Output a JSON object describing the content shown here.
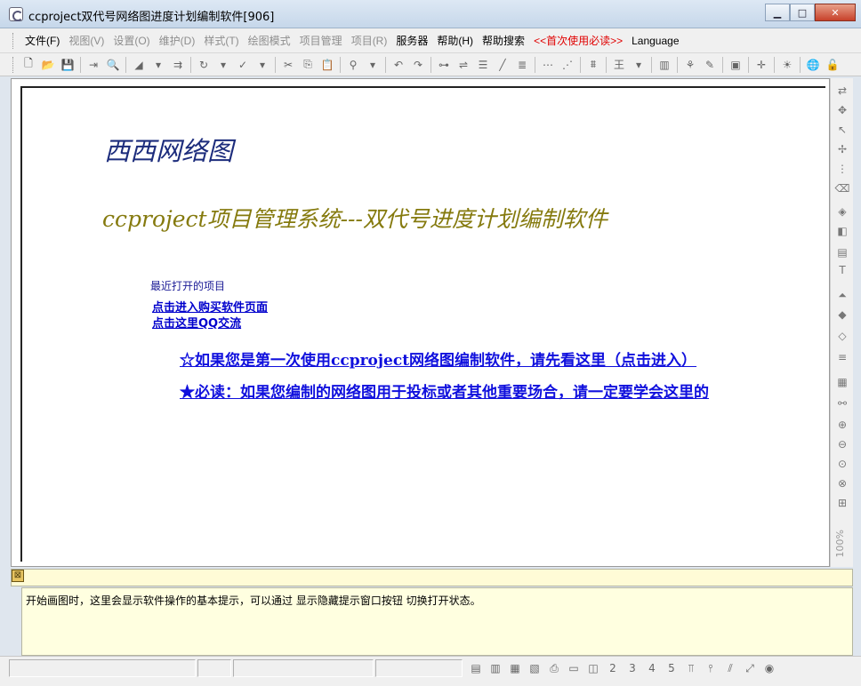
{
  "window": {
    "title": "ccproject双代号网络图进度计划编制软件[906]",
    "minimize": "▁",
    "maximize": "□",
    "close": "✕"
  },
  "menu": [
    {
      "label": "文件(F)",
      "enabled": true,
      "name": "menu-file"
    },
    {
      "label": "视图(V)",
      "enabled": false,
      "name": "menu-view"
    },
    {
      "label": "设置(O)",
      "enabled": false,
      "name": "menu-settings"
    },
    {
      "label": "维护(D)",
      "enabled": false,
      "name": "menu-maintain"
    },
    {
      "label": "样式(T)",
      "enabled": false,
      "name": "menu-style"
    },
    {
      "label": "绘图模式",
      "enabled": false,
      "name": "menu-draw-mode"
    },
    {
      "label": "项目管理",
      "enabled": false,
      "name": "menu-project-mgmt"
    },
    {
      "label": "项目(R)",
      "enabled": false,
      "name": "menu-project"
    },
    {
      "label": "服务器",
      "enabled": true,
      "name": "menu-server"
    },
    {
      "label": "帮助(H)",
      "enabled": true,
      "name": "menu-help"
    },
    {
      "label": "帮助搜索",
      "enabled": true,
      "name": "menu-help-search"
    },
    {
      "label": "<<首次使用必读>>",
      "enabled": true,
      "highlight": "#e00000",
      "name": "menu-first-use"
    },
    {
      "label": "Language",
      "enabled": true,
      "name": "menu-language"
    }
  ],
  "toolbar": [
    {
      "icon": "new-file-icon",
      "glyph": "🗋",
      "enabled": true
    },
    {
      "icon": "open-folder-icon",
      "glyph": "📂",
      "enabled": true
    },
    {
      "icon": "save-icon",
      "glyph": "💾",
      "enabled": false
    },
    {
      "sep": true
    },
    {
      "icon": "export-icon",
      "glyph": "⇥",
      "enabled": false
    },
    {
      "icon": "print-preview-icon",
      "glyph": "🔍",
      "enabled": false
    },
    {
      "sep": true
    },
    {
      "icon": "fill-color-icon",
      "glyph": "◢",
      "enabled": false
    },
    {
      "icon": "dropdown-arrow-icon",
      "glyph": "▾",
      "enabled": false
    },
    {
      "icon": "indent-icon",
      "glyph": "⇉",
      "enabled": false
    },
    {
      "sep": true
    },
    {
      "icon": "rotate-icon",
      "glyph": "↻",
      "enabled": false
    },
    {
      "icon": "dropdown-arrow-icon",
      "glyph": "▾",
      "enabled": false
    },
    {
      "icon": "check-icon",
      "glyph": "✓",
      "enabled": false
    },
    {
      "icon": "dropdown-arrow-icon",
      "glyph": "▾",
      "enabled": false
    },
    {
      "sep": true
    },
    {
      "icon": "cut-icon",
      "glyph": "✂",
      "enabled": false
    },
    {
      "icon": "copy-icon",
      "glyph": "⎘",
      "enabled": false
    },
    {
      "icon": "paste-icon",
      "glyph": "📋",
      "enabled": false
    },
    {
      "sep": true
    },
    {
      "icon": "find-binoculars-icon",
      "glyph": "⚲",
      "enabled": false
    },
    {
      "icon": "dropdown-arrow-icon",
      "glyph": "▾",
      "enabled": false
    },
    {
      "sep": true
    },
    {
      "icon": "undo-icon",
      "glyph": "↶",
      "enabled": false
    },
    {
      "icon": "redo-icon",
      "glyph": "↷",
      "enabled": false
    },
    {
      "sep": true
    },
    {
      "icon": "network-node-icon",
      "glyph": "⊶",
      "enabled": false
    },
    {
      "icon": "link-icon",
      "glyph": "⇌",
      "enabled": false
    },
    {
      "icon": "align-icon",
      "glyph": "☰",
      "enabled": false
    },
    {
      "icon": "line-icon",
      "glyph": "╱",
      "enabled": false
    },
    {
      "icon": "layer-icon",
      "glyph": "≣",
      "enabled": false
    },
    {
      "sep": true
    },
    {
      "icon": "node-row-icon",
      "glyph": "⋯",
      "enabled": false
    },
    {
      "icon": "node-row2-icon",
      "glyph": "⋰",
      "enabled": false
    },
    {
      "sep": true
    },
    {
      "icon": "arrange-icon",
      "glyph": "⩩",
      "enabled": false
    },
    {
      "sep": true
    },
    {
      "icon": "text-align-icon",
      "glyph": "王",
      "enabled": false
    },
    {
      "icon": "dropdown-arrow-icon",
      "glyph": "▾",
      "enabled": false
    },
    {
      "sep": true
    },
    {
      "icon": "bar-chart-icon",
      "glyph": "▥",
      "enabled": false
    },
    {
      "sep": true
    },
    {
      "icon": "resource-icon",
      "glyph": "⚘",
      "enabled": false
    },
    {
      "icon": "edit-doc-icon",
      "glyph": "✎",
      "enabled": false
    },
    {
      "sep": true
    },
    {
      "icon": "frame-icon",
      "glyph": "▣",
      "enabled": false
    },
    {
      "sep": true
    },
    {
      "icon": "add-node-icon",
      "glyph": "✛",
      "enabled": false
    },
    {
      "sep": true
    },
    {
      "icon": "tip-bulb-icon",
      "glyph": "☀",
      "enabled": false
    },
    {
      "sep": true
    },
    {
      "icon": "globe-icon",
      "glyph": "🌐",
      "enabled": true,
      "globe": true
    },
    {
      "icon": "unlock-icon",
      "glyph": "🔓",
      "enabled": true
    }
  ],
  "canvas": {
    "brand": "西西网络图",
    "subtitle": "ccproject项目管理系统---双代号进度计划编制软件",
    "recent_label": "最近打开的项目",
    "link_buy": "点击进入购买软件页面",
    "link_qq": "点击这里QQ交流",
    "first_use_link": "☆如果您是第一次使用ccproject网络图编制软件，请先看这里（点击进入）",
    "must_read_link": "★必读：如果您编制的网络图用于投标或者其他重要场合，请一定要学会这里的"
  },
  "side_toolbar": [
    {
      "icon": "move-arrows-icon",
      "glyph": "⇄"
    },
    {
      "icon": "pan-icon",
      "glyph": "✥"
    },
    {
      "icon": "select-pointer-icon",
      "glyph": "↖"
    },
    {
      "icon": "move-cross-icon",
      "glyph": "✢"
    },
    {
      "icon": "connect-icon",
      "glyph": "⋮"
    },
    {
      "icon": "eraser-icon",
      "glyph": "⌫"
    },
    {
      "icon": "tag-icon",
      "glyph": "◈"
    },
    {
      "icon": "set-icon",
      "glyph": "◧"
    },
    {
      "icon": "table-icon",
      "glyph": "▤"
    },
    {
      "icon": "text-icon",
      "glyph": "T"
    },
    {
      "icon": "up-level-icon",
      "glyph": "⏶"
    },
    {
      "icon": "layers-icon",
      "glyph": "◆"
    },
    {
      "icon": "label-icon",
      "glyph": "◇"
    },
    {
      "icon": "lines-icon",
      "glyph": "≡"
    },
    {
      "icon": "grid-icon",
      "glyph": "▦"
    },
    {
      "icon": "zoom-tool-icon",
      "glyph": "⚯"
    },
    {
      "icon": "zoom-in-icon",
      "glyph": "⊕"
    },
    {
      "icon": "zoom-out-icon",
      "glyph": "⊖"
    },
    {
      "icon": "zoom-fit-icon",
      "glyph": "⊙"
    },
    {
      "icon": "zoom-area-icon",
      "glyph": "⊗"
    },
    {
      "icon": "zoom-actual-icon",
      "glyph": "⊞"
    }
  ],
  "zoom_label": "100%",
  "hint": {
    "close_glyph": "⊠",
    "text": "开始画图时，这里会显示软件操作的基本提示，可以通过 显示隐藏提示窗口按钮 切换打开状态。"
  },
  "status_icons": [
    {
      "icon": "view-list-icon",
      "glyph": "▤"
    },
    {
      "icon": "view-table-icon",
      "glyph": "▥"
    },
    {
      "icon": "view-grid-icon",
      "glyph": "▦"
    },
    {
      "icon": "view-frame-icon",
      "glyph": "▧"
    },
    {
      "icon": "print-icon",
      "glyph": "⎙"
    },
    {
      "icon": "calendar-icon",
      "glyph": "▭"
    },
    {
      "icon": "schedule-icon",
      "glyph": "◫"
    },
    {
      "icon": "level2-icon",
      "glyph": "2"
    },
    {
      "icon": "level3-icon",
      "glyph": "3"
    },
    {
      "icon": "level4-icon",
      "glyph": "4"
    },
    {
      "icon": "level5-icon",
      "glyph": "5"
    },
    {
      "icon": "align-top-icon",
      "glyph": "⫪"
    },
    {
      "icon": "align-mid-icon",
      "glyph": "⫯"
    },
    {
      "icon": "distribute-icon",
      "glyph": "⫽"
    },
    {
      "icon": "fit-page-icon",
      "glyph": "⤢"
    },
    {
      "icon": "record-icon",
      "glyph": "◉"
    }
  ]
}
